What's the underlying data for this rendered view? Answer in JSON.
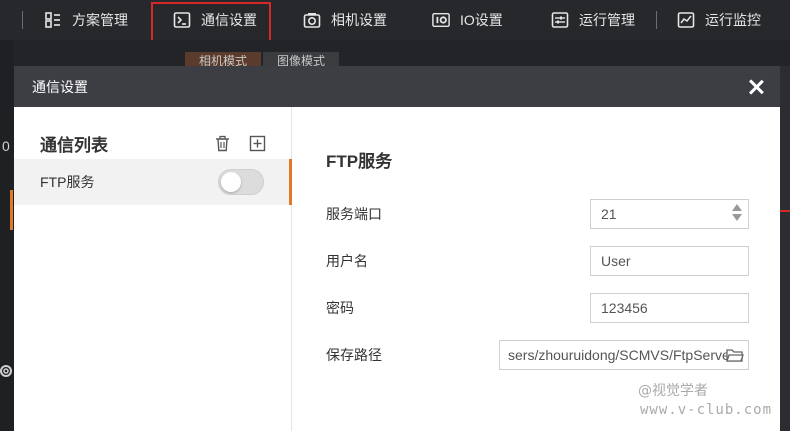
{
  "toolbar": {
    "items": [
      {
        "label": "方案管理",
        "icon": "scheme-icon"
      },
      {
        "label": "通信设置",
        "icon": "terminal-icon"
      },
      {
        "label": "相机设置",
        "icon": "camera-icon"
      },
      {
        "label": "IO设置",
        "icon": "io-icon"
      },
      {
        "label": "运行管理",
        "icon": "sliders-icon"
      },
      {
        "label": "运行监控",
        "icon": "monitor-icon"
      }
    ]
  },
  "background": {
    "tabs": [
      "相机模式",
      "图像模式"
    ],
    "left_number": "0"
  },
  "dialog": {
    "title": "通信设置",
    "list": {
      "title": "通信列表",
      "items": [
        {
          "label": "FTP服务",
          "enabled": false
        }
      ]
    },
    "detail": {
      "section_title": "FTP服务",
      "fields": {
        "port": {
          "label": "服务端口",
          "value": "21"
        },
        "username": {
          "label": "用户名",
          "value": "User"
        },
        "password": {
          "label": "密码",
          "value": "123456"
        },
        "save_path": {
          "label": "保存路径",
          "value": "sers/zhouruidong/SCMVS/FtpServer"
        }
      }
    }
  },
  "watermark": {
    "line1": "@视觉学者",
    "line2": "www.v-club.com"
  },
  "colors": {
    "accent": "#e07a2b",
    "highlight": "#d62828",
    "dialog_header": "#3c3e44"
  }
}
